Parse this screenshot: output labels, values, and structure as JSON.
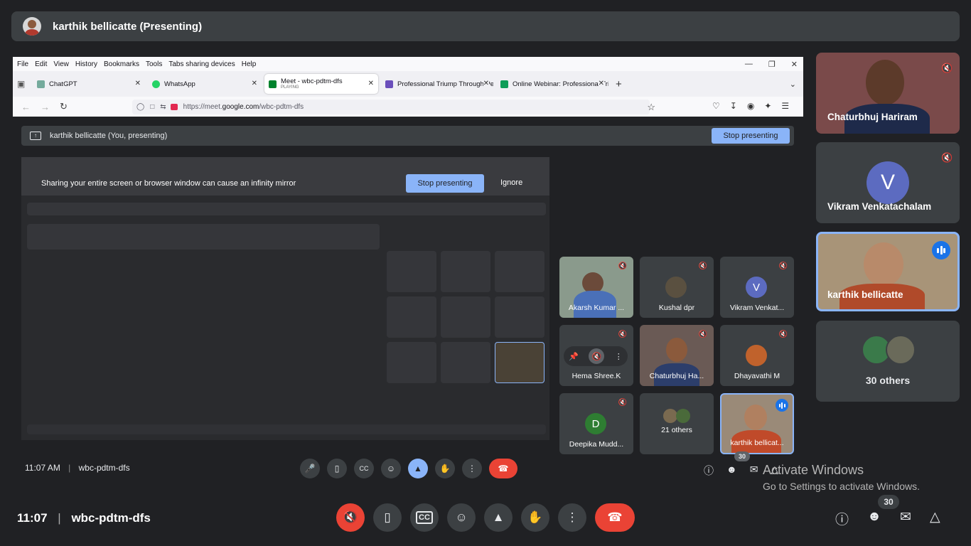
{
  "presenter_bar": {
    "title": "karthik bellicatte (Presenting)"
  },
  "browser": {
    "menu": [
      "File",
      "Edit",
      "View",
      "History",
      "Bookmarks",
      "Tools",
      "Tabs sharing devices",
      "Help"
    ],
    "tabs": [
      {
        "label": "ChatGPT",
        "color": "#74aa9c"
      },
      {
        "label": "WhatsApp",
        "color": "#25d366"
      },
      {
        "label": "Meet - wbc-pdtm-dfs",
        "sub": "PLAYING",
        "color": "#00832d"
      },
      {
        "label": "Professional Triump Through Pe",
        "color": "#6b4fbb"
      },
      {
        "label": "Online Webinar: Professional Tri",
        "color": "#0f9d58"
      }
    ],
    "url_prefix": "https://meet.",
    "url_domain": "google.com",
    "url_path": "/wbc-pdtm-dfs"
  },
  "inner_meet": {
    "presenting_label": "karthik bellicatte (You, presenting)",
    "stop_presenting": "Stop presenting",
    "warning": "Sharing your entire screen or browser window can cause an infinity mirror",
    "warning_stop": "Stop presenting",
    "warning_ignore": "Ignore",
    "time": "11:07 AM",
    "meeting_code": "wbc-pdtm-dfs",
    "people_count": "30",
    "participants": [
      {
        "name": "Akarsh Kumar ..."
      },
      {
        "name": "Kushal dpr"
      },
      {
        "name": "Vikram Venkat...",
        "initial": "V"
      },
      {
        "name": "Hema Shree.K"
      },
      {
        "name": "Chaturbhuj Ha..."
      },
      {
        "name": "Dhayavathi M"
      },
      {
        "name": "Deepika Mudd...",
        "initial": "D"
      },
      {
        "name": "21 others"
      },
      {
        "name": "karthik bellicat..."
      }
    ]
  },
  "sidebar": [
    {
      "name": "Chaturbhuj Hariram"
    },
    {
      "name": "Vikram Venkatachalam",
      "initial": "V"
    },
    {
      "name": "karthik bellicatte"
    },
    {
      "name": "30 others"
    }
  ],
  "watermark": {
    "line1": "Activate Windows",
    "line2": "Go to Settings to activate Windows."
  },
  "bottom": {
    "time": "11:07",
    "meeting_code": "wbc-pdtm-dfs",
    "people_count": "30"
  },
  "colors": {
    "end_call": "#ea4335",
    "accent": "#8ab4f8",
    "speaking": "#1a73e8"
  }
}
